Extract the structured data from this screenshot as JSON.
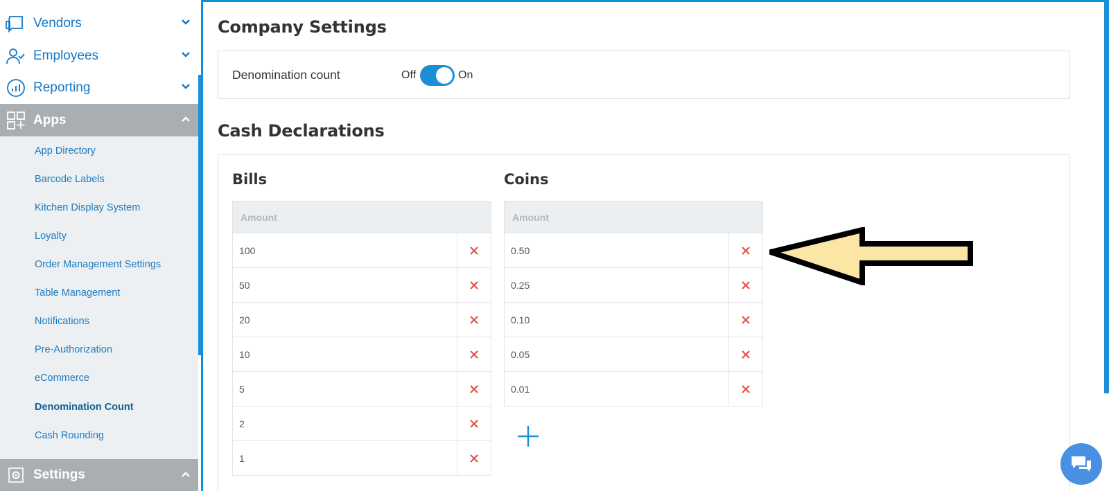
{
  "sidebar": {
    "nav": [
      {
        "label": "Vendors",
        "icon": "truck-icon"
      },
      {
        "label": "Employees",
        "icon": "employees-icon"
      },
      {
        "label": "Reporting",
        "icon": "reporting-icon"
      }
    ],
    "apps_section": {
      "label": "Apps",
      "icon": "apps-grid-icon"
    },
    "apps_items": [
      {
        "label": "App Directory"
      },
      {
        "label": "Barcode Labels"
      },
      {
        "label": "Kitchen Display System"
      },
      {
        "label": "Loyalty"
      },
      {
        "label": "Order Management Settings"
      },
      {
        "label": "Table Management"
      },
      {
        "label": "Notifications"
      },
      {
        "label": "Pre-Authorization"
      },
      {
        "label": "eCommerce"
      },
      {
        "label": "Denomination Count",
        "active": true
      },
      {
        "label": "Cash Rounding"
      }
    ],
    "settings_section": {
      "label": "Settings",
      "icon": "gear-icon"
    }
  },
  "main": {
    "company_settings_title": "Company Settings",
    "denomination_label": "Denomination count",
    "toggle": {
      "off_label": "Off",
      "on_label": "On",
      "state": "on"
    },
    "cash_declarations_title": "Cash Declarations",
    "bills": {
      "title": "Bills",
      "header": "Amount",
      "rows": [
        "100",
        "50",
        "20",
        "10",
        "5",
        "2",
        "1"
      ]
    },
    "coins": {
      "title": "Coins",
      "header": "Amount",
      "rows": [
        "0.50",
        "0.25",
        "0.10",
        "0.05",
        "0.01"
      ]
    }
  },
  "colors": {
    "accent": "#1b8fd6",
    "delete": "#e8453c",
    "section_bg": "#a9aeb3",
    "annotation_arrow_fill": "#fbe6a5"
  }
}
